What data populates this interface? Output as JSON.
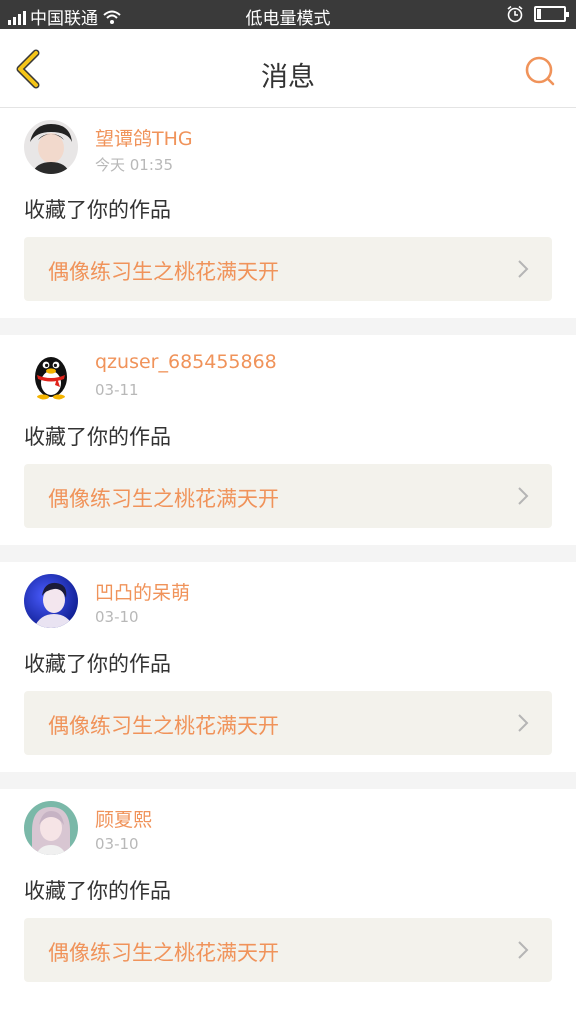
{
  "status_bar": {
    "carrier": "中国联通",
    "mode": "低电量模式",
    "battery_level": 0.15
  },
  "nav": {
    "title": "消息",
    "back_icon": "chevron-left-icon",
    "search_icon": "search-icon"
  },
  "colors": {
    "accent": "#f0935a",
    "back_arrow": "#f5c518",
    "text": "#333333",
    "muted": "#b8b8b8",
    "link_bg": "#f3f2ec"
  },
  "messages": [
    {
      "username": "望谭鸽THG",
      "time": "今天 01:35",
      "action": "收藏了你的作品",
      "work": "偶像练习生之桃花满天开",
      "avatar": "photo-avatar-icon"
    },
    {
      "username": "qzuser_685455868",
      "time": "03-11",
      "action": "收藏了你的作品",
      "work": "偶像练习生之桃花满天开",
      "avatar": "penguin-avatar-icon"
    },
    {
      "username": "凹凸的呆萌",
      "time": "03-10",
      "action": "收藏了你的作品",
      "work": "偶像练习生之桃花满天开",
      "avatar": "photo-avatar-icon"
    },
    {
      "username": "顾夏熙",
      "time": "03-10",
      "action": "收藏了你的作品",
      "work": "偶像练习生之桃花满天开",
      "avatar": "photo-avatar-icon"
    }
  ]
}
